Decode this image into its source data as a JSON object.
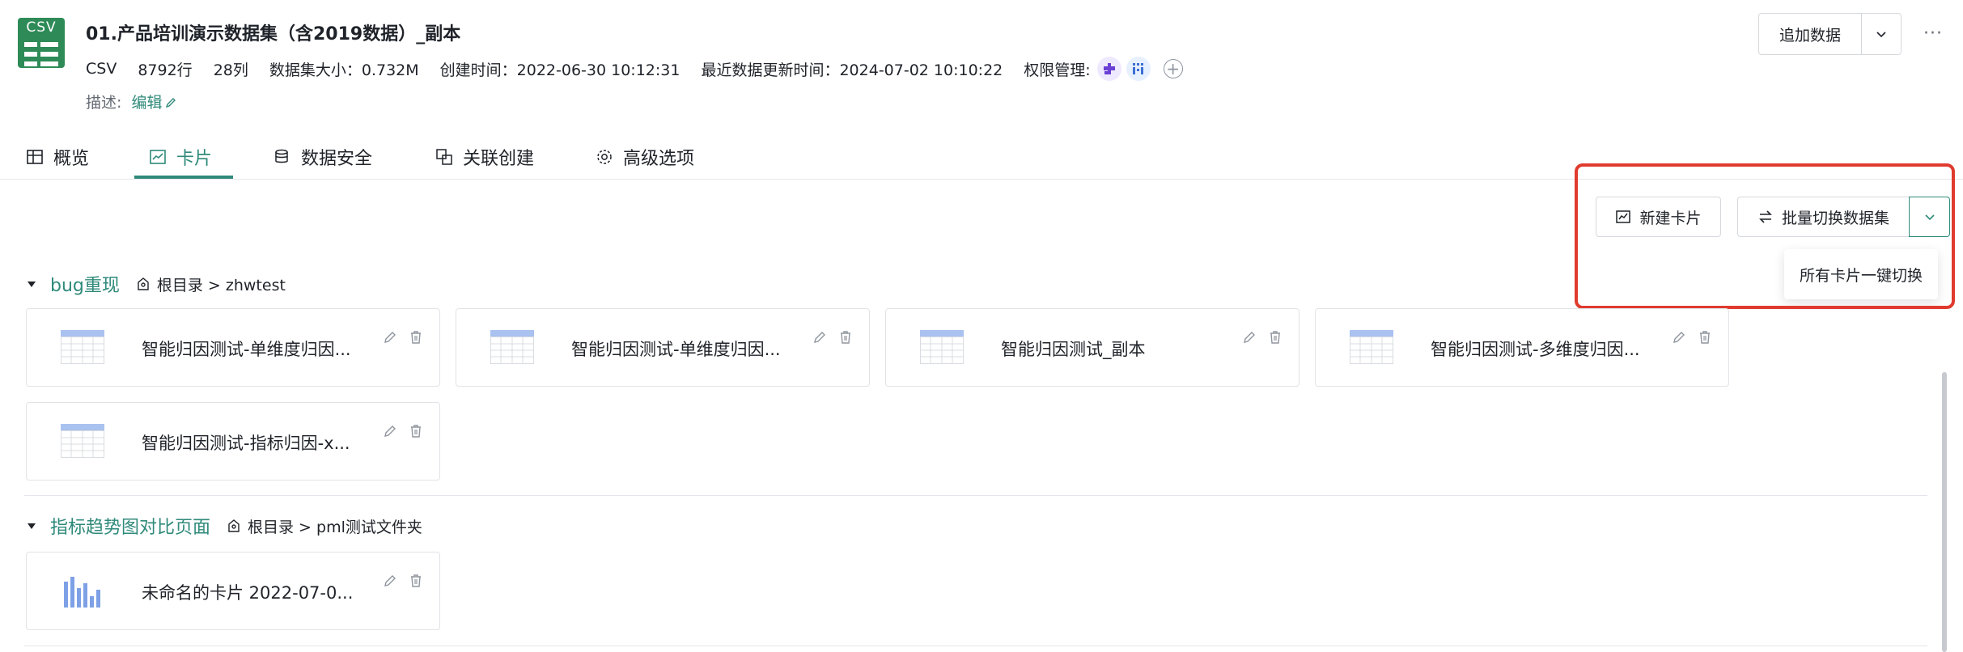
{
  "dataset": {
    "logo_text": "CSV",
    "title": "01.产品培训演示数据集（含2019数据）_副本",
    "type": "CSV",
    "rows": "8792行",
    "cols": "28列",
    "size": "数据集大小：0.732M",
    "created": "创建时间：2022-06-30 10:12:31",
    "updated": "最近数据更新时间：2024-07-02 10:10:22",
    "perm_label": "权限管理:",
    "desc_label": "描述:",
    "desc_edit": "编辑"
  },
  "toolbar": {
    "append_label": "追加数据",
    "more_label": "···"
  },
  "tabs": [
    {
      "label": "概览",
      "icon": "table-icon"
    },
    {
      "label": "卡片",
      "icon": "chart-icon"
    },
    {
      "label": "数据安全",
      "icon": "database-shield-icon"
    },
    {
      "label": "关联创建",
      "icon": "link-icon"
    },
    {
      "label": "高级选项",
      "icon": "gear-icon"
    }
  ],
  "actions": {
    "new_card": "新建卡片",
    "batch_switch": "批量切换数据集",
    "dropdown_item": "所有卡片一键切换"
  },
  "groups": [
    {
      "name": "bug重现",
      "path": "根目录 > zhwtest",
      "cards": [
        {
          "name": "智能归因测试-单维度归因...",
          "thumb": "table-thumb"
        },
        {
          "name": "智能归因测试-单维度归因...",
          "thumb": "table-thumb"
        },
        {
          "name": "智能归因测试_副本",
          "thumb": "table-thumb"
        },
        {
          "name": "智能归因测试-多维度归因...",
          "thumb": "table-thumb"
        },
        {
          "name": "智能归因测试-指标归因-x...",
          "thumb": "table-thumb"
        }
      ]
    },
    {
      "name": "指标趋势图对比页面",
      "path": "根目录 > pml测试文件夹",
      "cards": [
        {
          "name": "未命名的卡片 2022-07-0...",
          "thumb": "bar-chart-thumb"
        }
      ]
    }
  ],
  "colors": {
    "accent": "#2f8a7a",
    "logo": "#2e8b57",
    "highlight": "#e03b2f"
  }
}
